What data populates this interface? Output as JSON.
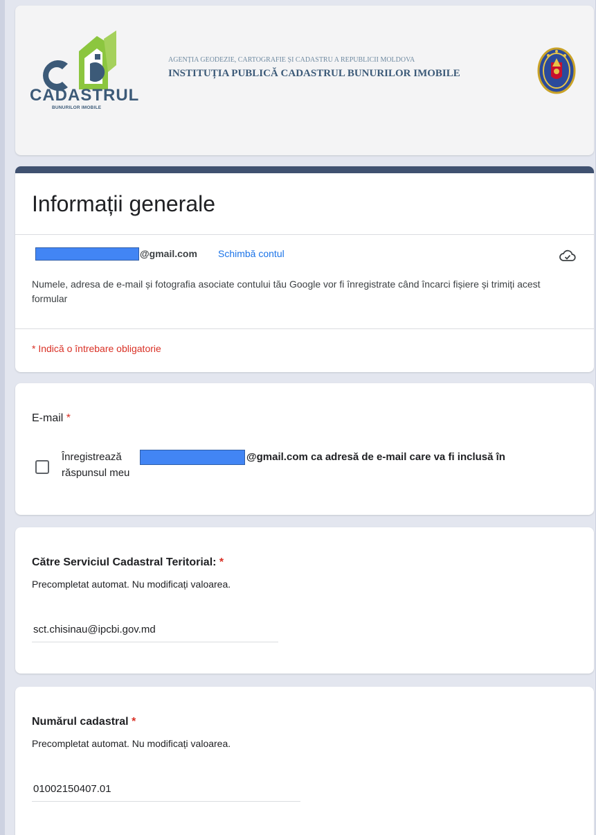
{
  "header": {
    "logo_word": "CADASTRUL",
    "logo_subtitle": "BUNURILOR IMOBILE",
    "agency": "AGENȚIA GEODEZIE, CARTOGRAFIE ȘI CADASTRU A REPUBLICII MOLDOVA",
    "institution": "INSTITUȚIA PUBLICĂ CADASTRUL BUNURILOR IMOBILE"
  },
  "form": {
    "title": "Informații generale",
    "account_email_suffix": "@gmail.com",
    "switch_account": "Schimbă contul",
    "notice": "Numele, adresa de e-mail și fotografia asociate contului tău Google vor fi înregistrate când încarci fișiere și trimiți acest formular",
    "required_note": "* Indică o întrebare obligatorie"
  },
  "email_question": {
    "label": "E-mail",
    "asterisk": "*",
    "checkbox_prefix": "Înregistrează",
    "checkbox_suffix": "@gmail.com ca adresă de e-mail care va fi inclusă în",
    "checkbox_line2": "răspunsul meu",
    "checked": false
  },
  "questions": [
    {
      "label": "Către Serviciul Cadastral Teritorial:",
      "asterisk": "*",
      "help": "Precompletat automat. Nu modificați valoarea.",
      "value": "sct.chisinau@ipcbi.gov.md"
    },
    {
      "label": "Numărul cadastral",
      "asterisk": "*",
      "help": "Precompletat automat. Nu modificați valoarea.",
      "value": "01002150407.01"
    }
  ],
  "icons": {
    "cloud": "cloud-done-icon",
    "emblem": "moldova-coat-of-arms",
    "logo": "cadastrul-logo"
  },
  "colors": {
    "accent": "#3f5170",
    "link": "#1a73e8",
    "required": "#d93025",
    "background": "#cdd2e1"
  }
}
